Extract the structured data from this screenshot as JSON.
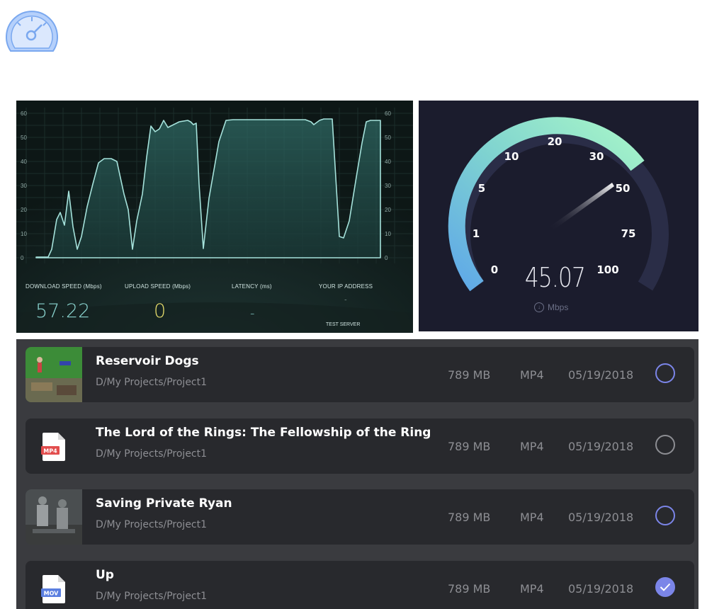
{
  "app": {
    "logo_icon": "speedometer-icon",
    "accent": "#7b85e8"
  },
  "speed_chart": {
    "y_ticks": [
      "60",
      "50",
      "40",
      "30",
      "20",
      "10",
      "0"
    ],
    "stats": {
      "download_label": "DOWNLOAD SPEED (Mbps)",
      "upload_label": "UPLOAD SPEED (Mbps)",
      "latency_label": "LATENCY (ms)",
      "ip_label": "YOUR IP ADDRESS",
      "download_value": "57.22",
      "upload_value": "0",
      "latency_value": "-",
      "ip_value": "-",
      "server_label": "TEST SERVER"
    }
  },
  "speed_gauge": {
    "value": "45.07",
    "unit": "Mbps",
    "unit_icon": "download-arrow-icon",
    "scale_labels": [
      "0",
      "1",
      "5",
      "10",
      "20",
      "30",
      "50",
      "75",
      "100"
    ]
  },
  "files": [
    {
      "title": "Reservoir Dogs",
      "path": "D/My Projects/Project1",
      "size": "789 MB",
      "type": "MP4",
      "date": "05/19/2018",
      "thumb": "image",
      "selected": false
    },
    {
      "title": "The Lord of the Rings: The Fellowship of the Ring",
      "path": "D/My Projects/Project1",
      "size": "789 MB",
      "type": "MP4",
      "date": "05/19/2018",
      "thumb": "file-icon",
      "thumb_label": "MP4",
      "selected": false
    },
    {
      "title": "Saving Private Ryan",
      "path": "D/My Projects/Project1",
      "size": "789 MB",
      "type": "MP4",
      "date": "05/19/2018",
      "thumb": "image",
      "selected": false
    },
    {
      "title": "Up",
      "path": "D/My Projects/Project1",
      "size": "789 MB",
      "type": "MP4",
      "date": "05/19/2018",
      "thumb": "file-icon",
      "thumb_label": "MOV",
      "selected": true
    }
  ]
}
